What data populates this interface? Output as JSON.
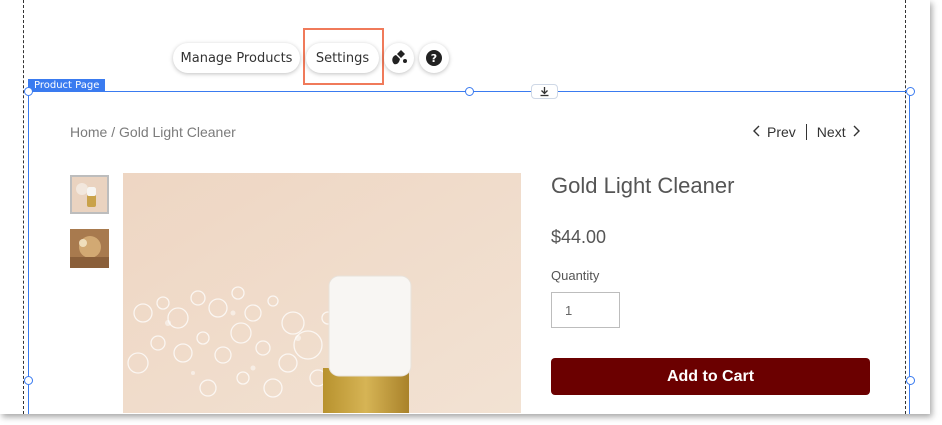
{
  "toolbar": {
    "manage_products_label": "Manage Products",
    "settings_label": "Settings",
    "design_icon": "paint-drop-icon",
    "help_icon": "question-mark-icon"
  },
  "selection": {
    "label": "Product Page",
    "accent_color": "#3a7bf0",
    "highlight_color": "#f07a5a"
  },
  "breadcrumb": {
    "home": "Home",
    "separator": "/",
    "current": "Gold Light Cleaner"
  },
  "pagination": {
    "prev": "Prev",
    "next": "Next"
  },
  "product": {
    "name": "Gold Light Cleaner",
    "price": "$44.00",
    "quantity_label": "Quantity",
    "quantity_value": "1",
    "add_to_cart_label": "Add to Cart",
    "button_color": "#6b0000"
  }
}
